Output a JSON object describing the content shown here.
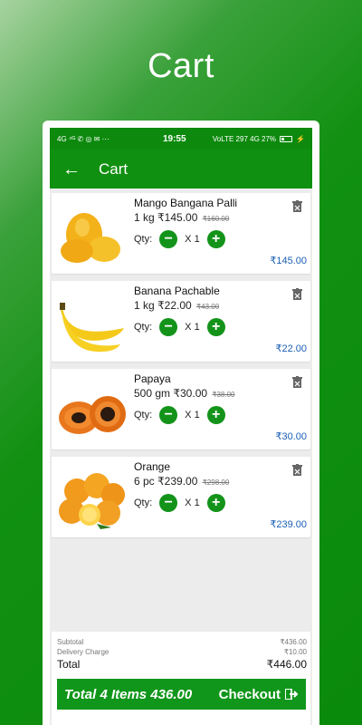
{
  "hero": {
    "title": "Cart"
  },
  "status_bar": {
    "left": "4G ⁴ᴳ ✆ ◎ ✉ ⋯",
    "time": "19:55",
    "right": "VoLTE 297 4G 27%"
  },
  "toolbar": {
    "title": "Cart"
  },
  "items": [
    {
      "name": "Mango Bangana Palli",
      "unit": "1 kg",
      "price": "₹145.00",
      "mrp": "₹160.00",
      "qty_label": "Qty:",
      "qty": "X 1",
      "total": "₹145.00",
      "image": "mango-image"
    },
    {
      "name": "Banana Pachable",
      "unit": "1 kg",
      "price": "₹22.00",
      "mrp": "₹43.00",
      "qty_label": "Qty:",
      "qty": "X 1",
      "total": "₹22.00",
      "image": "banana-image"
    },
    {
      "name": "Papaya",
      "unit": "500 gm",
      "price": "₹30.00",
      "mrp": "₹38.00",
      "qty_label": "Qty:",
      "qty": "X 1",
      "total": "₹30.00",
      "image": "papaya-image"
    },
    {
      "name": "Orange",
      "unit": "6 pc",
      "price": "₹239.00",
      "mrp": "₹298.00",
      "qty_label": "Qty:",
      "qty": "X 1",
      "total": "₹239.00",
      "image": "orange-image"
    }
  ],
  "summary": {
    "subtotal_label": "Subtotal",
    "subtotal": "₹436.00",
    "delivery_label": "Delivery Charge",
    "delivery": "₹10.00",
    "total_label": "Total",
    "total": "₹446.00"
  },
  "checkout": {
    "items_text": "Total 4 Items 436.00",
    "button_label": "Checkout"
  },
  "colors": {
    "primary": "#109010",
    "accent_blue": "#1a5fb4",
    "button": "#13931a"
  }
}
